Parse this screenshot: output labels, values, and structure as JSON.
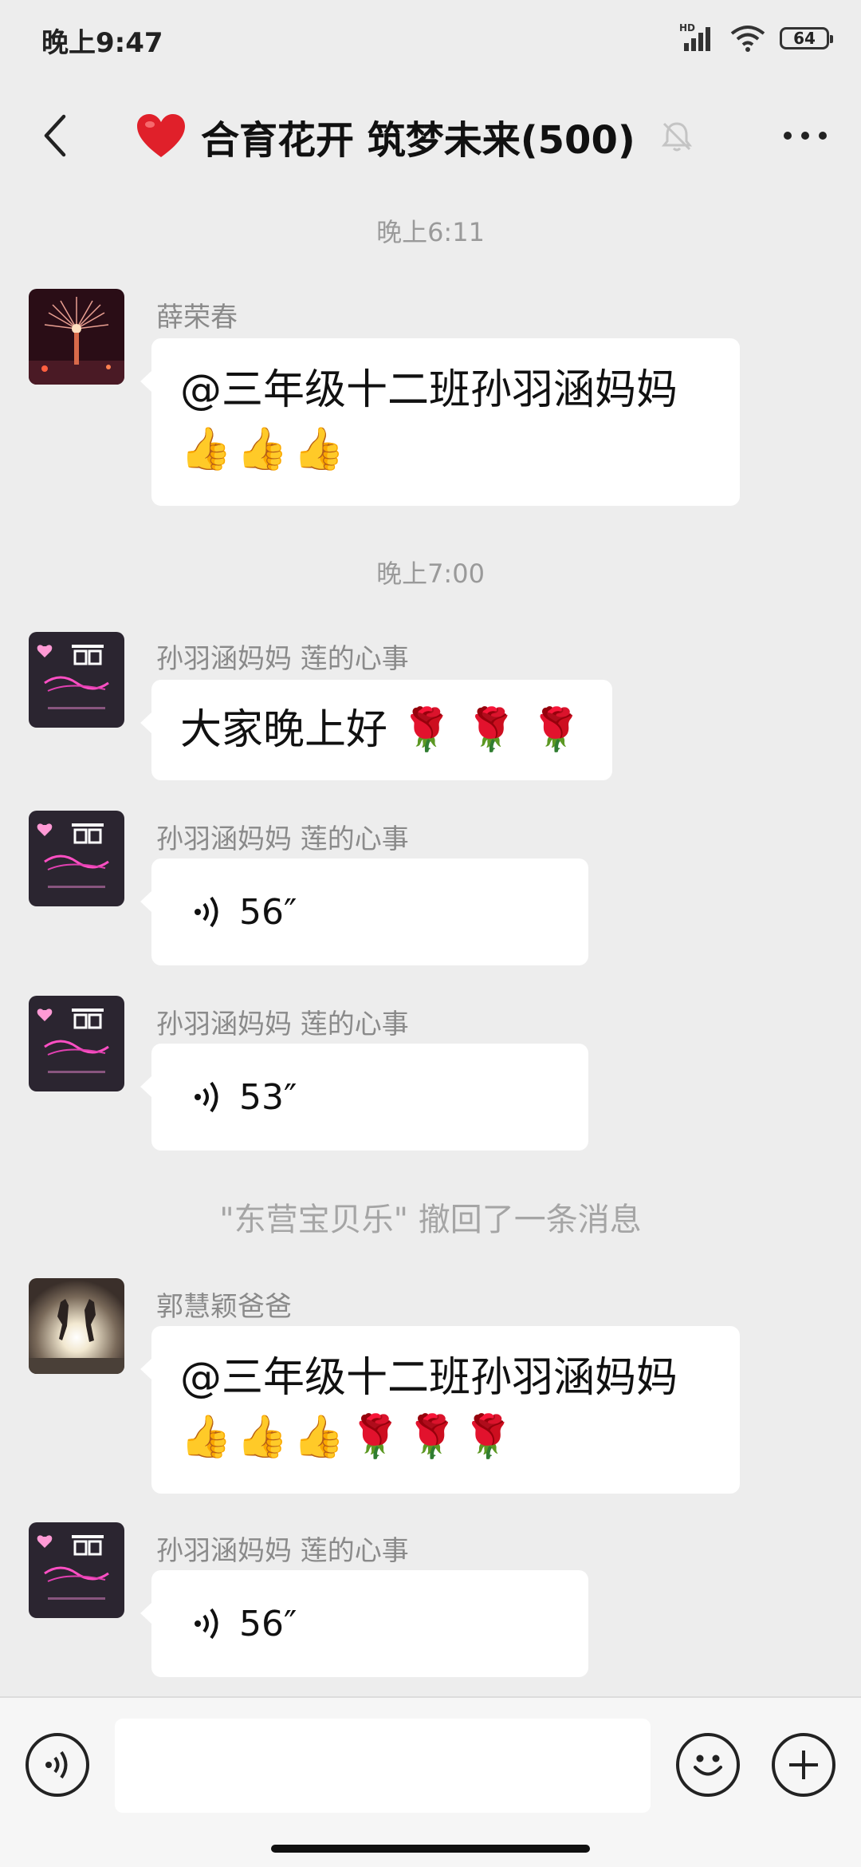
{
  "status_bar": {
    "time": "晚上9:47",
    "network": "HD",
    "battery": "64"
  },
  "header": {
    "title": "合育花开 筑梦未来(500)",
    "title_icon": "red-heart-emoji",
    "muted": true
  },
  "messages": {
    "ts1": "晚上6:11",
    "m1": {
      "sender": "薛荣春",
      "text": "@三年级十二班孙羽涵妈妈",
      "emojis": [
        "👍",
        "👍",
        "👍"
      ]
    },
    "ts2": "晚上7:00",
    "m2": {
      "sender": "孙羽涵妈妈  莲的心事",
      "text": "大家晚上好",
      "emojis": [
        "🌹",
        "🌹",
        "🌹"
      ]
    },
    "m3": {
      "sender": "孙羽涵妈妈  莲的心事",
      "duration": "56″"
    },
    "m4": {
      "sender": "孙羽涵妈妈  莲的心事",
      "duration": "53″"
    },
    "recall": "\"东营宝贝乐\" 撤回了一条消息",
    "m5": {
      "sender": "郭慧颖爸爸",
      "text": "@三年级十二班孙羽涵妈妈",
      "emojis": [
        "👍",
        "👍",
        "👍",
        "🌹",
        "🌹",
        "🌹"
      ]
    },
    "m6": {
      "sender": "孙羽涵妈妈  莲的心事",
      "duration": "56″"
    }
  },
  "composer": {
    "input_value": "",
    "voice_icon": "voice-input-icon",
    "emoji_icon": "smiley-icon",
    "plus_icon": "plus-icon"
  },
  "colors": {
    "background": "#ededed",
    "bubble": "#ffffff",
    "meta_text": "#9a9a9a"
  }
}
